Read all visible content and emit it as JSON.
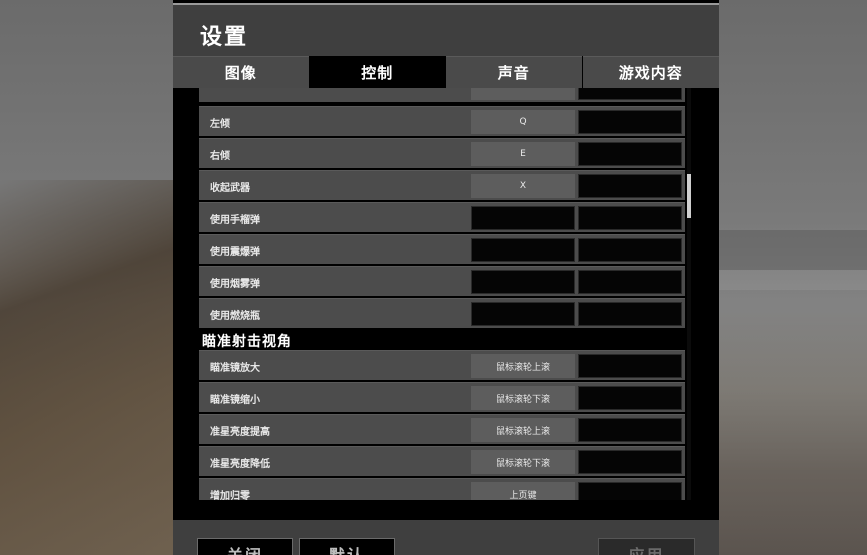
{
  "window": {
    "title": "设置"
  },
  "tabs": [
    {
      "label": "图像",
      "active": false
    },
    {
      "label": "控制",
      "active": true
    },
    {
      "label": "声音",
      "active": false
    },
    {
      "label": "游戏内容",
      "active": false
    }
  ],
  "rows": [
    {
      "label": "",
      "key1": "",
      "key2": ""
    },
    {
      "label": "左倾",
      "key1": "Q",
      "key2": ""
    },
    {
      "label": "右倾",
      "key1": "E",
      "key2": ""
    },
    {
      "label": "收起武器",
      "key1": "X",
      "key2": ""
    },
    {
      "label": "使用手榴弹",
      "key1": "",
      "key2": ""
    },
    {
      "label": "使用震爆弹",
      "key1": "",
      "key2": ""
    },
    {
      "label": "使用烟雾弹",
      "key1": "",
      "key2": ""
    },
    {
      "label": "使用燃烧瓶",
      "key1": "",
      "key2": ""
    }
  ],
  "section": {
    "title": "瞄准射击视角"
  },
  "aim_rows": [
    {
      "label": "瞄准镜放大",
      "key1": "鼠标滚轮上滚",
      "key2": ""
    },
    {
      "label": "瞄准镜缩小",
      "key1": "鼠标滚轮下滚",
      "key2": ""
    },
    {
      "label": "准星亮度提高",
      "key1": "鼠标滚轮上滚",
      "key2": ""
    },
    {
      "label": "准星亮度降低",
      "key1": "鼠标滚轮下滚",
      "key2": ""
    },
    {
      "label": "增加归零",
      "key1": "上页键",
      "key2": ""
    }
  ],
  "buttons": {
    "close": "关闭",
    "default": "默认",
    "apply": "应用"
  },
  "colors": {
    "panel_bg": "#000000",
    "title_bar": "#3f3f3f",
    "tab_bg": "#4a4a4a",
    "row_bg": "#4c4c4c",
    "key_bg": "#5d5d5d"
  }
}
